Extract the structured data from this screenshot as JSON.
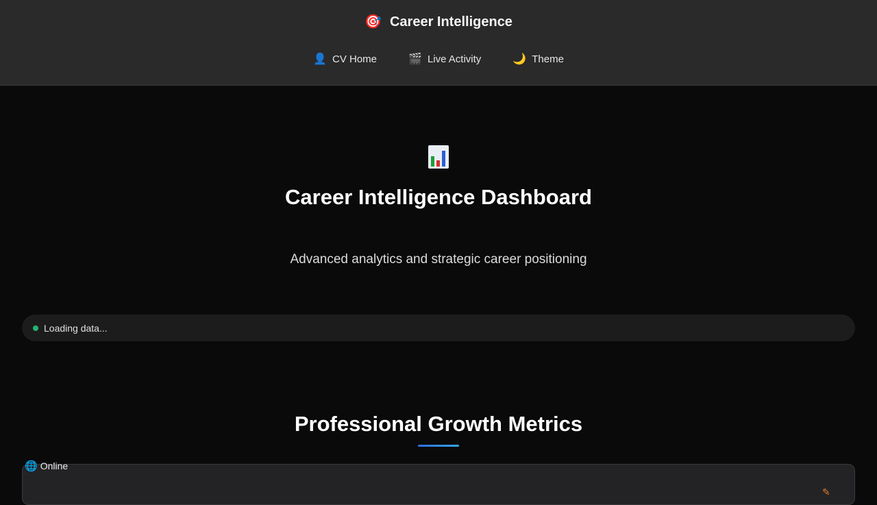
{
  "header": {
    "brand_icon": "🎯",
    "brand_title": "Career Intelligence",
    "nav": [
      {
        "icon": "👤",
        "label": "CV Home"
      },
      {
        "icon": "🎬",
        "label": "Live Activity"
      },
      {
        "icon": "🌙",
        "label": "Theme"
      }
    ]
  },
  "hero": {
    "icon": "bar-chart-icon",
    "title": "Career Intelligence Dashboard",
    "subtitle": "Advanced analytics and strategic career positioning"
  },
  "status": {
    "text": "Loading data...",
    "dot_color": "#22b573"
  },
  "section": {
    "title": "Professional Growth Metrics"
  },
  "connection": {
    "icon": "🌐",
    "label": "Online"
  },
  "colors": {
    "accent": "#2f6fe4",
    "header_bg": "#2a2a2b",
    "page_bg": "#0a0a0b"
  }
}
